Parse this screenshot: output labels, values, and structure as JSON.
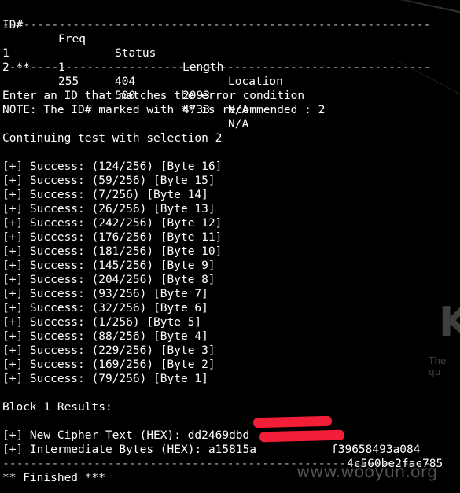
{
  "table": {
    "headers": [
      "ID#",
      "Freq",
      "Status",
      "Length",
      "Location"
    ],
    "separator": "-------------------------------------------------------------",
    "rows": [
      [
        "1",
        "1",
        "404",
        "2093",
        "N/A"
      ],
      [
        "2 **",
        "255",
        "500",
        "4733",
        "N/A"
      ]
    ]
  },
  "prompt": {
    "line1": "Enter an ID that matches the error condition",
    "line2": "NOTE: The ID# marked with ** is recommended : 2"
  },
  "continuing": "Continuing test with selection 2",
  "progress": [
    "[+] Success: (124/256) [Byte 16]",
    "[+] Success: (59/256) [Byte 15]",
    "[+] Success: (7/256) [Byte 14]",
    "[+] Success: (26/256) [Byte 13]",
    "[+] Success: (242/256) [Byte 12]",
    "[+] Success: (176/256) [Byte 11]",
    "[+] Success: (181/256) [Byte 10]",
    "[+] Success: (145/256) [Byte 9]",
    "[+] Success: (204/256) [Byte 8]",
    "[+] Success: (93/256) [Byte 7]",
    "[+] Success: (32/256) [Byte 6]",
    "[+] Success: (1/256) [Byte 5]",
    "[+] Success: (88/256) [Byte 4]",
    "[+] Success: (229/256) [Byte 3]",
    "[+] Success: (169/256) [Byte 2]",
    "[+] Success: (79/256) [Byte 1]"
  ],
  "results": {
    "title": "Block 1 Results:",
    "cipher_prefix": "[+] New Cipher Text (HEX): dd2469dbd",
    "cipher_suffix": "f39658493a084",
    "intermediate_prefix": "[+] Intermediate Bytes (HEX): a15815a",
    "intermediate_suffix": "4c560be2fac785"
  },
  "footer": {
    "separator": "-------------------------------------------------------------",
    "finished": "** Finished ***"
  },
  "watermark": "www.wooyun.org",
  "background_logo": {
    "glyph": "K",
    "tagline": "The qu"
  },
  "colors": {
    "background": "#000000",
    "text": "#ffffff",
    "redaction": "#ff1f3a"
  }
}
